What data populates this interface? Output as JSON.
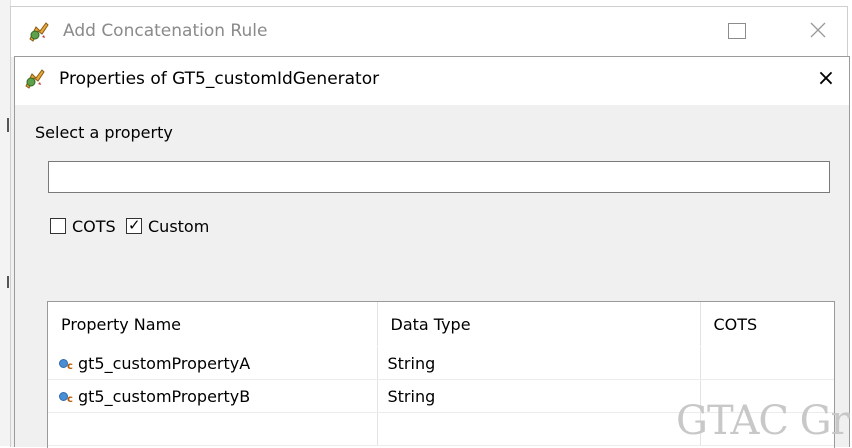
{
  "outer_window": {
    "title": "Add Concatenation Rule",
    "maximize_icon": "maximize-icon",
    "close_icon": "close-icon"
  },
  "dialog": {
    "title": "Properties of GT5_customIdGenerator",
    "close_glyph": "×",
    "close_icon": "close-icon"
  },
  "select_label": "Select a property",
  "filter": {
    "value": "",
    "placeholder": ""
  },
  "filters": {
    "cots": {
      "label": "COTS",
      "checked": false
    },
    "custom": {
      "label": "Custom",
      "checked": true,
      "check_glyph": "✓"
    }
  },
  "table": {
    "columns": [
      "Property Name",
      "Data Type",
      "COTS"
    ],
    "rows": [
      {
        "name": "gt5_customPropertyA",
        "type": "String",
        "cots": "",
        "icon": "custom-property-icon",
        "icon_sub": "c"
      },
      {
        "name": "gt5_customPropertyB",
        "type": "String",
        "cots": "",
        "icon": "custom-property-icon",
        "icon_sub": "c"
      }
    ]
  },
  "watermark": "GTAC Gr",
  "colors": {
    "property_icon": "#4a8fd6",
    "property_icon_sub": "#b85a00",
    "dialog_bg": "#f0f0f0"
  }
}
